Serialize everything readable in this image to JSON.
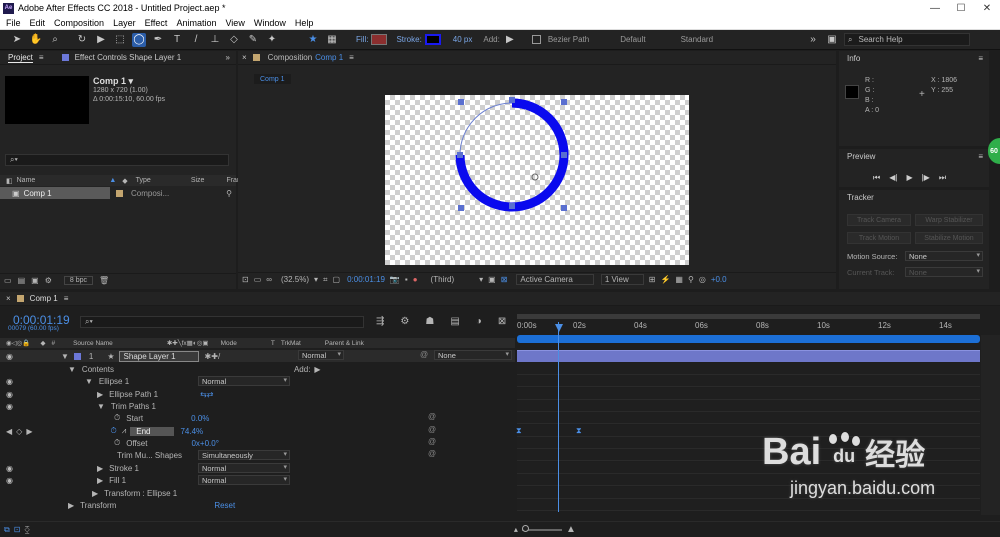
{
  "titlebar": {
    "title": "Adobe After Effects CC 2018 - Untitled Project.aep *",
    "logo": "Ae",
    "minimize": "—",
    "maximize": "☐",
    "close": "✕"
  },
  "menu": [
    "File",
    "Edit",
    "Composition",
    "Layer",
    "Effect",
    "Animation",
    "View",
    "Window",
    "Help"
  ],
  "toolbar": {
    "fill_label": "Fill:",
    "stroke_label": "Stroke:",
    "stroke_width": "40 px",
    "add_label": "Add:",
    "bezier_label": "Bezier Path",
    "workspace_default": "Default",
    "workspace_standard": "Standard",
    "search_placeholder": "Search Help",
    "fill_color": "#8b2e2e",
    "stroke_color": "#1a1af0"
  },
  "project": {
    "tab_project": "Project",
    "tab_effect": "Effect Controls Shape Layer 1",
    "comp_name": "Comp 1 ▾",
    "comp_res": "1280 x 720 (1.00)",
    "comp_dur": "Δ 0:00:15:10, 60.00 fps",
    "col_name": "Name",
    "col_type": "Type",
    "col_size": "Size",
    "col_frame": "Fran",
    "item_name": "Comp 1",
    "item_type": "Composi...",
    "bpc": "8 bpc"
  },
  "composition": {
    "tab_prefix": "Composition",
    "tab_name": "Comp 1",
    "subtab": "Comp 1",
    "zoom": "(32.5%)",
    "timecode": "0:00:01:19",
    "view_third": "(Third)",
    "camera": "Active Camera",
    "view_count": "1 View",
    "exposure": "+0.0"
  },
  "info": {
    "title": "Info",
    "r": "R :",
    "g": "G :",
    "b": "B :",
    "a": "A : 0",
    "x": "X : 1806",
    "y": "Y : 255"
  },
  "preview": {
    "title": "Preview"
  },
  "tracker": {
    "title": "Tracker",
    "track_camera": "Track Camera",
    "warp_stabilizer": "Warp Stabilizer",
    "track_motion": "Track Motion",
    "stabilize_motion": "Stabilize Motion",
    "motion_source_label": "Motion Source:",
    "motion_source_value": "None",
    "current_track_label": "Current Track:",
    "current_track_value": "None",
    "badge": "60"
  },
  "timeline": {
    "tab": "Comp 1",
    "timecode": "0:00:01:19",
    "frames": "00079 (60.00 fps)",
    "col_source": "Source Name",
    "col_mode": "Mode",
    "col_t": "T",
    "col_trkmat": "TrkMat",
    "col_parent": "Parent & Link",
    "layer": {
      "num": "1",
      "name": "Shape Layer 1",
      "mode": "Normal",
      "parent": "None"
    },
    "contents": "Contents",
    "add_label": "Add:",
    "ellipse": "Ellipse 1",
    "ellipse_mode": "Normal",
    "ellipse_path": "Ellipse Path 1",
    "trim": "Trim Paths 1",
    "start_label": "Start",
    "start_val": "0.0%",
    "end_label": "End",
    "end_val": "74.4%",
    "offset_label": "Offset",
    "offset_val": "0x+0.0°",
    "trim_multi_label": "Trim Mu... Shapes",
    "trim_multi_val": "Simultaneously",
    "stroke": "Stroke 1",
    "stroke_mode": "Normal",
    "fill": "Fill 1",
    "fill_mode": "Normal",
    "transform_ellipse": "Transform : Ellipse 1",
    "transform": "Transform",
    "reset": "Reset",
    "ruler": [
      "0:00s",
      "02s",
      "04s",
      "06s",
      "08s",
      "10s",
      "12s",
      "14s"
    ]
  },
  "watermark": {
    "brand": "Bai",
    "paw": "du",
    "cn": "经验",
    "url": "jingyan.baidu.com"
  }
}
